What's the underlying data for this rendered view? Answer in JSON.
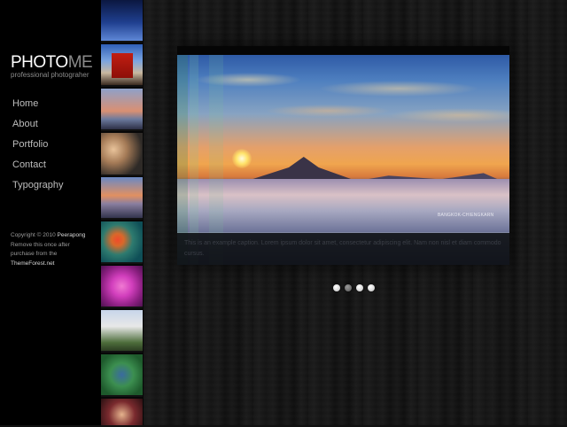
{
  "brand": {
    "logo_bold": "PHOTO",
    "logo_light": "ME",
    "tagline": "professional photograher"
  },
  "nav": {
    "items": [
      {
        "label": "Home"
      },
      {
        "label": "About"
      },
      {
        "label": "Portfolio"
      },
      {
        "label": "Contact"
      },
      {
        "label": "Typography"
      }
    ]
  },
  "footer": {
    "line1_prefix": "Copyright © 2010 ",
    "line1_name": "Peerapong",
    "line2": "Remove this once after",
    "line3": "purchase from the",
    "line4": "ThemeForest.net"
  },
  "slider": {
    "image_label": "BANGKOK-CHIENGKARN",
    "caption": "This is an example caption. Lorem ipsum dolor sit amet, consectetur adipiscing elit. Nam non nisl et diam commodo cursus.",
    "dots": [
      {
        "active": false
      },
      {
        "active": true
      },
      {
        "active": false
      },
      {
        "active": false
      }
    ],
    "active_slide": 2
  },
  "thumbnails": [
    {
      "name": "night-sky"
    },
    {
      "name": "red-pagoda"
    },
    {
      "name": "misty-mountains"
    },
    {
      "name": "smiling-people"
    },
    {
      "name": "sunset-clouds"
    },
    {
      "name": "orange-flower"
    },
    {
      "name": "pink-flowers"
    },
    {
      "name": "white-castle"
    },
    {
      "name": "garden-trees"
    },
    {
      "name": "people-portrait"
    }
  ],
  "colors": {
    "background": "#111111",
    "sidebar": "#000000",
    "text_muted": "#bdbdbd",
    "caption_bg": "#0a0c10"
  }
}
